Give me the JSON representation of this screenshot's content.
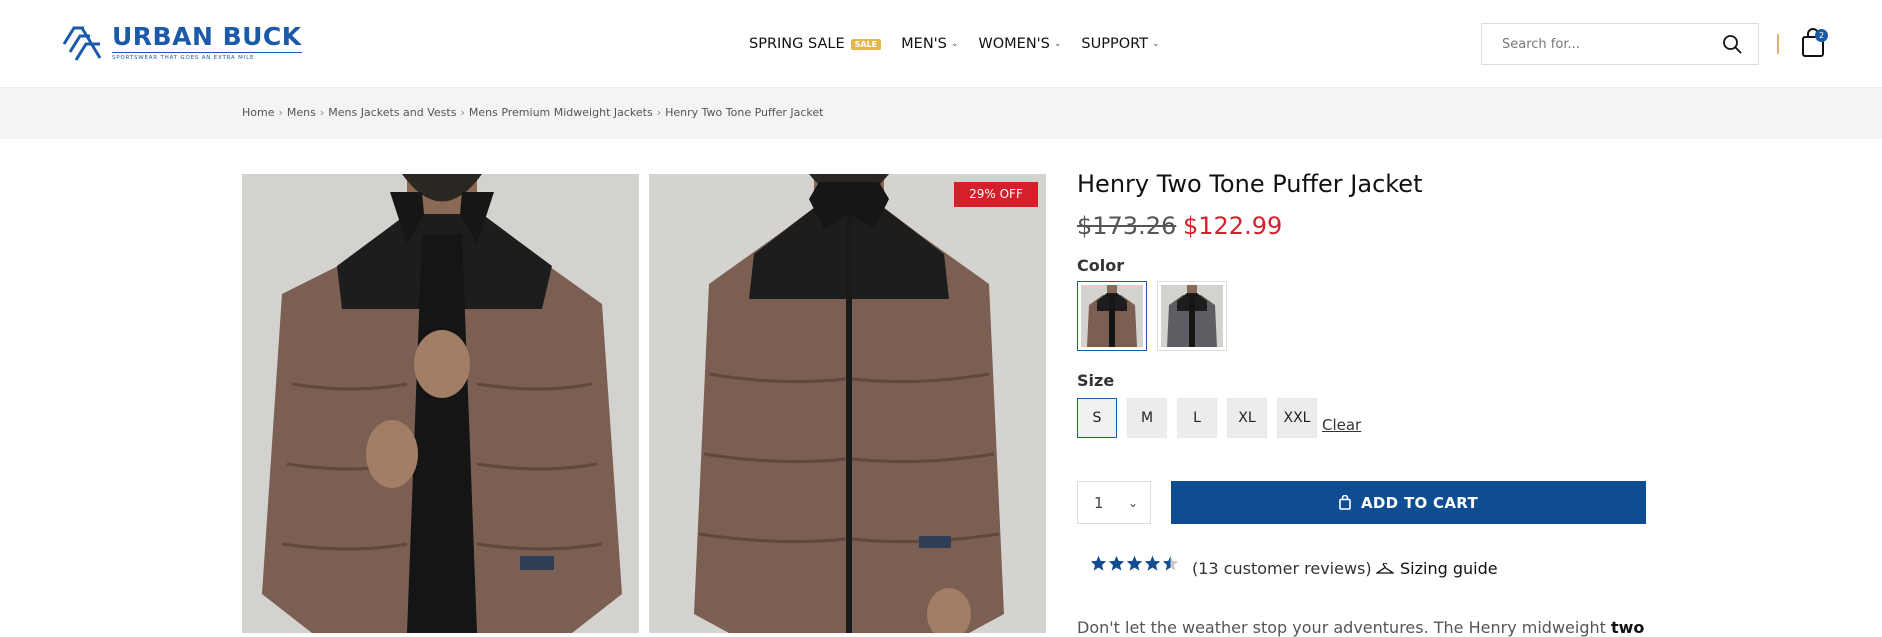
{
  "brand": {
    "name": "URBAN BUCK",
    "tagline": "SPORTSWEAR THAT GOES AN EXTRA MILE",
    "accent": "#1b5aa8"
  },
  "nav": {
    "items": [
      {
        "label": "SPRING SALE",
        "badge": "SALE"
      },
      {
        "label": "MEN'S"
      },
      {
        "label": "WOMEN'S"
      },
      {
        "label": "SUPPORT"
      }
    ]
  },
  "search": {
    "placeholder": "Search for..."
  },
  "cart": {
    "count": "2"
  },
  "breadcrumb": [
    "Home",
    "Mens",
    "Mens Jackets and Vests",
    "Mens Premium Midweight Jackets",
    "Henry Two Tone Puffer Jacket"
  ],
  "product": {
    "discount_badge": "29% OFF",
    "title": "Henry Two Tone Puffer Jacket",
    "price_old": "$173.26",
    "price_new": "$122.99",
    "color_label": "Color",
    "size_label": "Size",
    "sizes": [
      "S",
      "M",
      "L",
      "XL",
      "XXL"
    ],
    "selected_size": "S",
    "clear_label": "Clear",
    "quantity": "1",
    "add_to_cart_label": "ADD TO CART",
    "rating": 4.5,
    "reviews_text": "(13 customer reviews)",
    "sizing_guide_label": "Sizing guide",
    "description_start": "Don't let the weather stop your adventures. The Henry midweight",
    "description_bold": "two"
  },
  "colors": {
    "sale": "#d4202a",
    "primary_button": "#0e4d91",
    "sale_badge": "#e5b74a"
  }
}
